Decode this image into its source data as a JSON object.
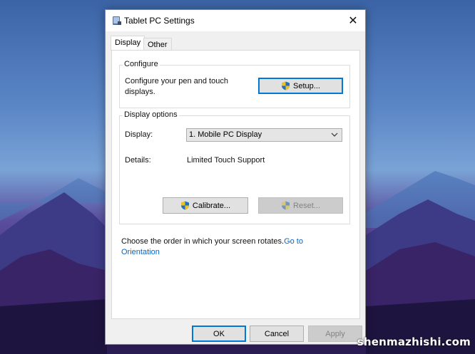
{
  "window": {
    "title": "Tablet PC Settings",
    "close_glyph": "✕"
  },
  "tabs": [
    {
      "label": "Display",
      "selected": true
    },
    {
      "label": "Other",
      "selected": false
    }
  ],
  "configure": {
    "group_label": "Configure",
    "description_line1": "Configure your pen and touch",
    "description_line2": "displays.",
    "setup_button": "Setup..."
  },
  "display_options": {
    "group_label": "Display options",
    "display_label": "Display:",
    "display_value": "1. Mobile PC Display",
    "details_label": "Details:",
    "details_value": "Limited Touch Support",
    "calibrate_button": "Calibrate...",
    "reset_button": "Reset..."
  },
  "orientation": {
    "text": "Choose the order in which your screen rotates.",
    "link_part1": "Go to",
    "link_part2": "Orientation"
  },
  "footer": {
    "ok": "OK",
    "cancel": "Cancel",
    "apply": "Apply"
  },
  "watermark": "shenmazhishi.com",
  "colors": {
    "accent": "#0078d7",
    "link": "#0066cc",
    "disabled_button": "#cccccc",
    "window_bg": "#f0f0f0"
  },
  "icons": [
    "tablet-settings-icon",
    "close-icon",
    "uac-shield-icon",
    "chevron-down-icon"
  ]
}
